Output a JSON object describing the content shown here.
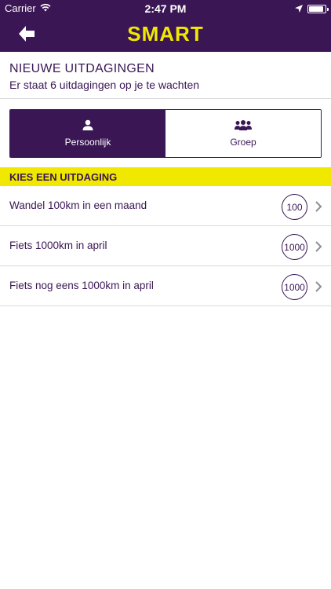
{
  "status_bar": {
    "carrier": "Carrier",
    "time": "2:47 PM",
    "battery_level": 0.9,
    "icons": [
      "wifi-icon",
      "location-arrow-icon",
      "battery-icon"
    ]
  },
  "nav_bar": {
    "logo": "SMART",
    "back_icon": "back-arrow-icon"
  },
  "header": {
    "title": "NIEUWE UITDAGINGEN",
    "subtitle": "Er staat 6 uitdagingen op je te wachten"
  },
  "segments": [
    {
      "label": "Persoonlijk",
      "icon": "person-icon",
      "active": true
    },
    {
      "label": "Groep",
      "icon": "group-icon",
      "active": false
    }
  ],
  "section": {
    "title": "KIES EEN UITDAGING"
  },
  "challenges": [
    {
      "label": "Wandel 100km in een maand",
      "points": "100"
    },
    {
      "label": "Fiets 1000km in april",
      "points": "1000"
    },
    {
      "label": "Fiets nog eens 1000km in april",
      "points": "1000"
    }
  ],
  "colors": {
    "primary": "#3a1654",
    "accent": "#f1e800",
    "divider": "#d9d9d9",
    "chevron": "#8e8e93"
  }
}
